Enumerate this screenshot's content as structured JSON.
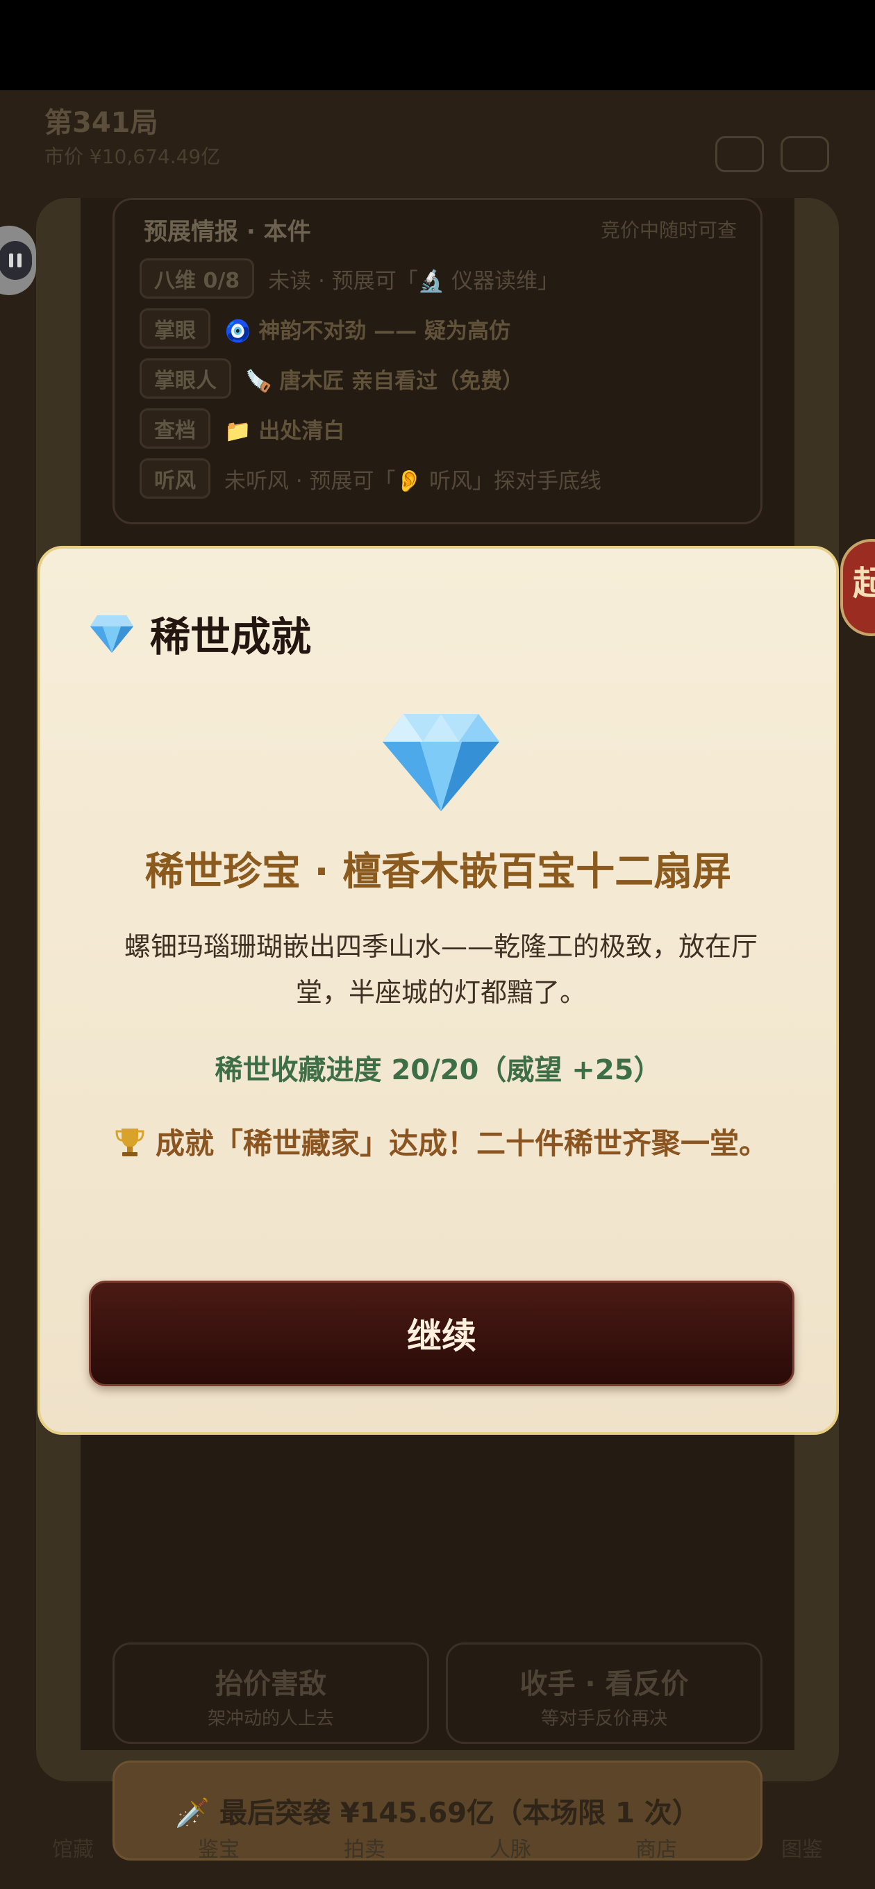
{
  "background": {
    "header_title": "第341局",
    "header_subtitle": "市价 ¥10,674.49亿",
    "intel": {
      "title": "预展情报 · 本件",
      "hint": "竞价中随时可查",
      "rows": [
        {
          "tag": "八维 0/8",
          "text": "未读 · 预展可「🔬 仪器读维」"
        },
        {
          "tag": "掌眼",
          "text": "🧿 神韵不对劲 —— 疑为高仿"
        },
        {
          "tag": "掌眼人",
          "text": "🪚 唐木匠 亲自看过（免费）"
        },
        {
          "tag": "查档",
          "text": "📁 出处清白"
        },
        {
          "tag": "听风",
          "text": "未听风 · 预展可「👂 听风」探对手底线"
        }
      ]
    },
    "raise_button": {
      "title": "抬价害敌",
      "subtitle": "架冲动的人上去"
    },
    "fold_button": {
      "title": "收手 · 看反价",
      "subtitle": "等对手反价再决"
    },
    "raid_button": "🗡️ 最后突袭 ¥145.69亿（本场限 1 次）",
    "nav": [
      "馆藏",
      "鉴宝",
      "拍卖",
      "人脉",
      "商店",
      "图鉴"
    ],
    "side_badge": "起"
  },
  "modal": {
    "title": "稀世成就",
    "treasure_name": "稀世珍宝 · 檀香木嵌百宝十二扇屏",
    "description": "螺钿玛瑙珊瑚嵌出四季山水——乾隆工的极致，放在厅堂，半座城的灯都黯了。",
    "progress": "稀世收藏进度 20/20（威望 +25）",
    "achievement": "成就「稀世藏家」达成！二十件稀世齐聚一堂。",
    "continue_label": "继续",
    "colors": {
      "title": "#8b5a1e",
      "progress": "#3e6e46",
      "achievement": "#8a5520",
      "button": "#3a1210"
    }
  }
}
